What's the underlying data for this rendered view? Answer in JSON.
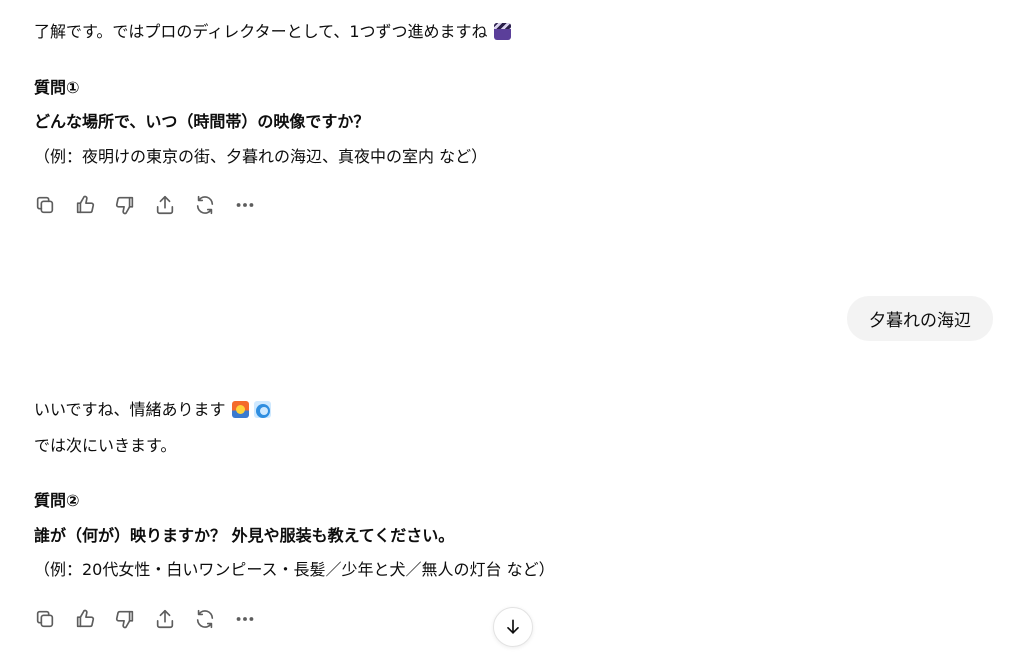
{
  "conversation": {
    "message1": {
      "intro": "了解です。ではプロのディレクターとして、1つずつ進めますね",
      "intro_emoji": "clapper-board-emoji",
      "question_heading": "質問①",
      "question_text": "どんな場所で、いつ（時間帯）の映像ですか？",
      "question_example": "（例：夜明けの東京の街、夕暮れの海辺、真夜中の室内 など）"
    },
    "user_reply": "夕暮れの海辺",
    "message2": {
      "line1": "いいですね、情緒あります",
      "line1_emojis": [
        "sunset-emoji",
        "water-wave-emoji"
      ],
      "line2": "では次にいきます。",
      "question_heading": "質問②",
      "question_text": "誰が（何が）映りますか？ 外見や服装も教えてください。",
      "question_example": "（例：20代女性・白いワンピース・長髪／少年と犬／無人の灯台 など）"
    }
  },
  "action_bar": {
    "icons": [
      "copy-icon",
      "thumbs-up-icon",
      "thumbs-down-icon",
      "share-icon",
      "regenerate-icon",
      "more-icon"
    ]
  },
  "colors": {
    "text": "#0d0d0d",
    "icon": "#5d5d5d",
    "bubble_bg": "#f3f3f3",
    "background": "#ffffff"
  }
}
